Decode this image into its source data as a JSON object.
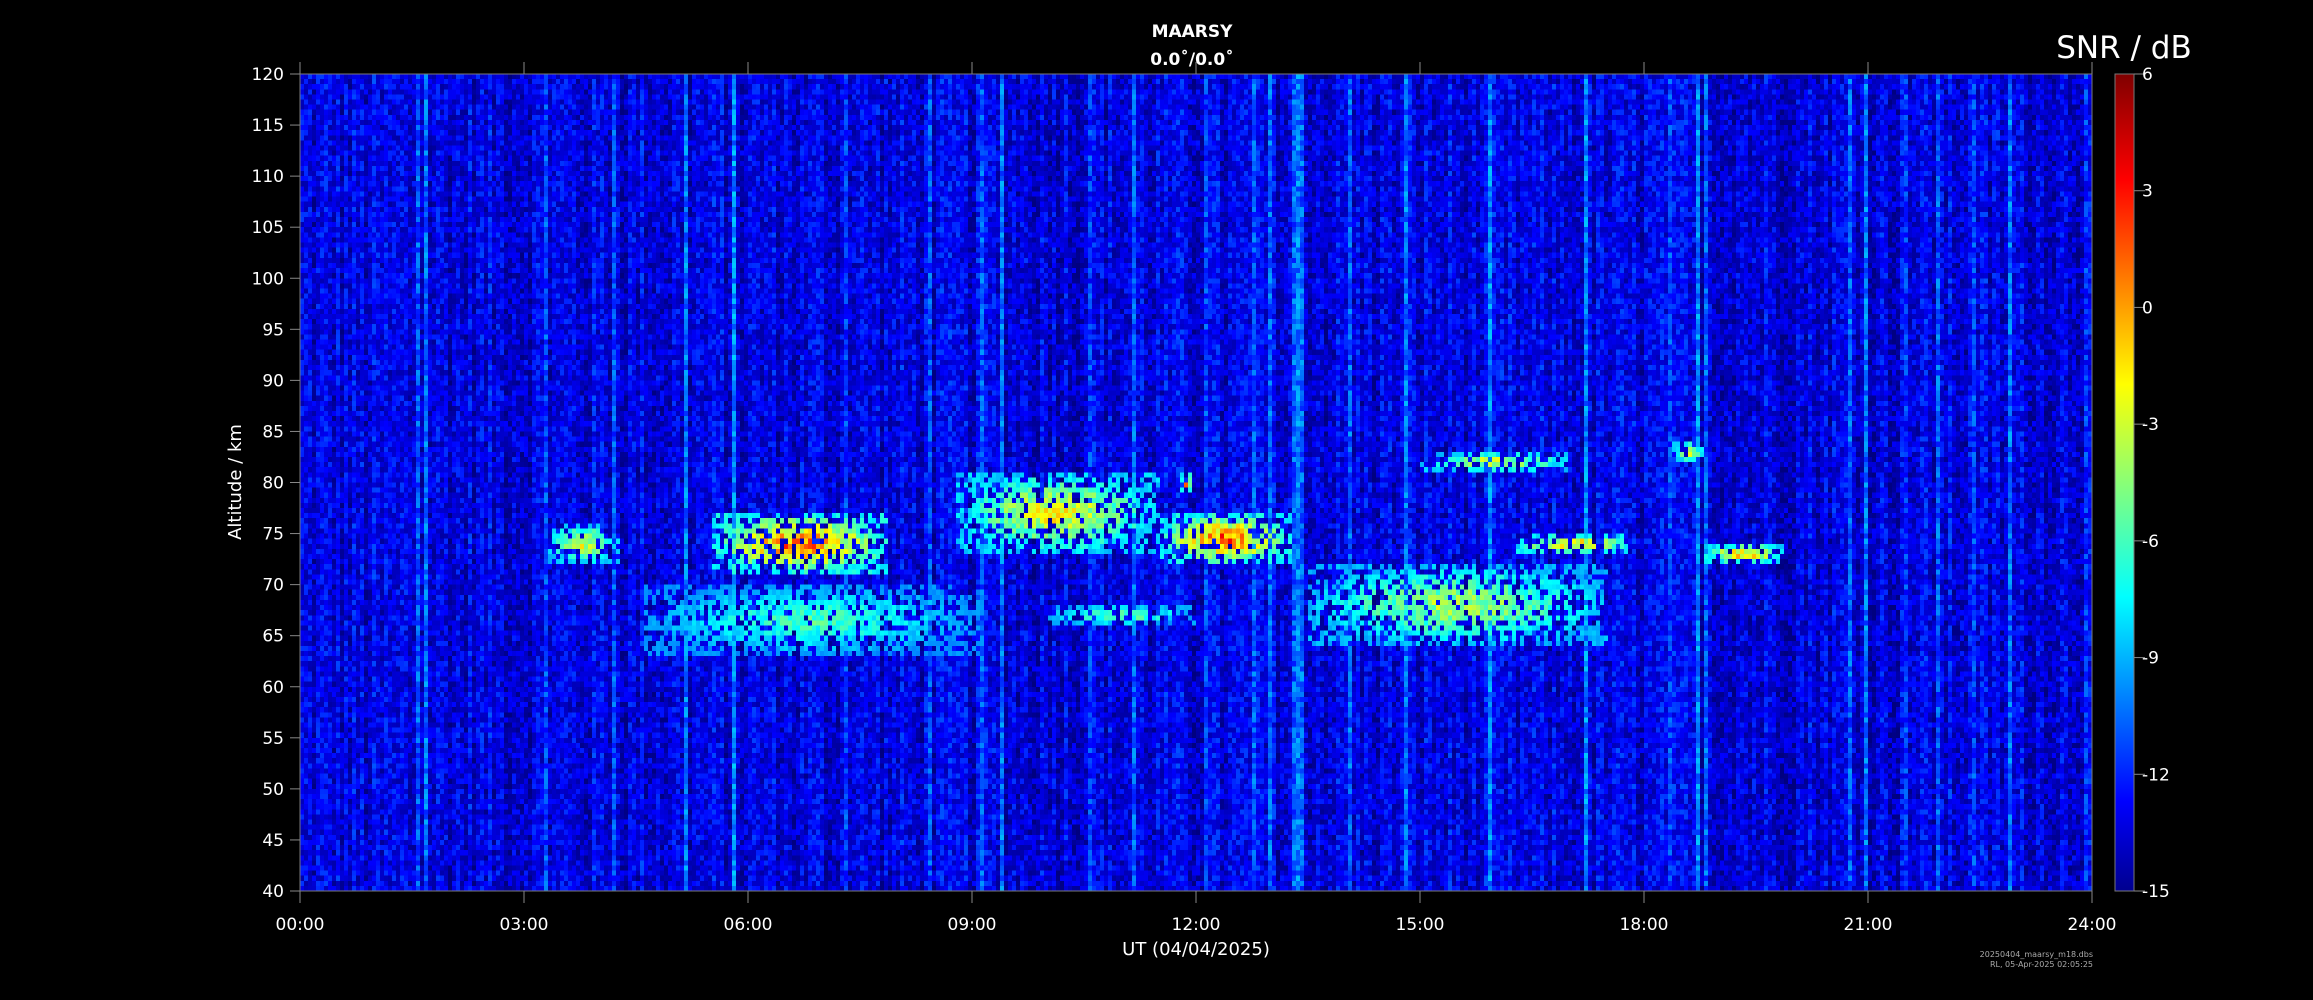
{
  "chart_data": {
    "type": "heatmap",
    "title": "MAARSY",
    "subtitle": "0.0˚/0.0˚",
    "xlabel": "UT (04/04/2025)",
    "ylabel": "Altitude / km",
    "xlim": [
      0,
      24
    ],
    "ylim": [
      40,
      120
    ],
    "x_ticks": [
      "00:00",
      "03:00",
      "06:00",
      "09:00",
      "12:00",
      "15:00",
      "18:00",
      "21:00",
      "24:00"
    ],
    "y_ticks": [
      40,
      45,
      50,
      55,
      60,
      65,
      70,
      75,
      80,
      85,
      90,
      95,
      100,
      105,
      110,
      115,
      120
    ],
    "colorbar": {
      "title": "SNR / dB",
      "range": [
        -15,
        6
      ],
      "ticks": [
        -15,
        -12,
        -9,
        -6,
        -3,
        0,
        3,
        6
      ],
      "colormap": "jet"
    },
    "background_level_db": -13,
    "echo_regions": [
      {
        "t_start": 3.3,
        "t_end": 4.3,
        "alt_bottom": 72,
        "alt_top": 76,
        "peak_db": 0
      },
      {
        "t_start": 5.5,
        "t_end": 7.9,
        "alt_bottom": 71,
        "alt_top": 77,
        "peak_db": 5
      },
      {
        "t_start": 4.6,
        "t_end": 9.1,
        "alt_bottom": 63,
        "alt_top": 70,
        "peak_db": -4
      },
      {
        "t_start": 8.8,
        "t_end": 11.5,
        "alt_bottom": 73,
        "alt_top": 81,
        "peak_db": 1
      },
      {
        "t_start": 10.0,
        "t_end": 12.0,
        "alt_bottom": 66,
        "alt_top": 68,
        "peak_db": -3
      },
      {
        "t_start": 11.5,
        "t_end": 13.3,
        "alt_bottom": 72,
        "alt_top": 77,
        "peak_db": 5
      },
      {
        "t_start": 11.8,
        "t_end": 11.95,
        "alt_bottom": 79,
        "alt_top": 81,
        "peak_db": 5
      },
      {
        "t_start": 13.5,
        "t_end": 17.5,
        "alt_bottom": 64,
        "alt_top": 72,
        "peak_db": -1
      },
      {
        "t_start": 15.0,
        "t_end": 17.0,
        "alt_bottom": 81,
        "alt_top": 83,
        "peak_db": 0
      },
      {
        "t_start": 16.3,
        "t_end": 17.8,
        "alt_bottom": 73,
        "alt_top": 75,
        "peak_db": 3
      },
      {
        "t_start": 18.4,
        "t_end": 18.8,
        "alt_bottom": 82,
        "alt_top": 84,
        "peak_db": 0
      },
      {
        "t_start": 18.8,
        "t_end": 19.9,
        "alt_bottom": 72,
        "alt_top": 74,
        "peak_db": 3
      }
    ],
    "footer": [
      "20250404_maarsy_m18.dbs",
      "RL, 05-Apr-2025 02:05:25"
    ]
  }
}
